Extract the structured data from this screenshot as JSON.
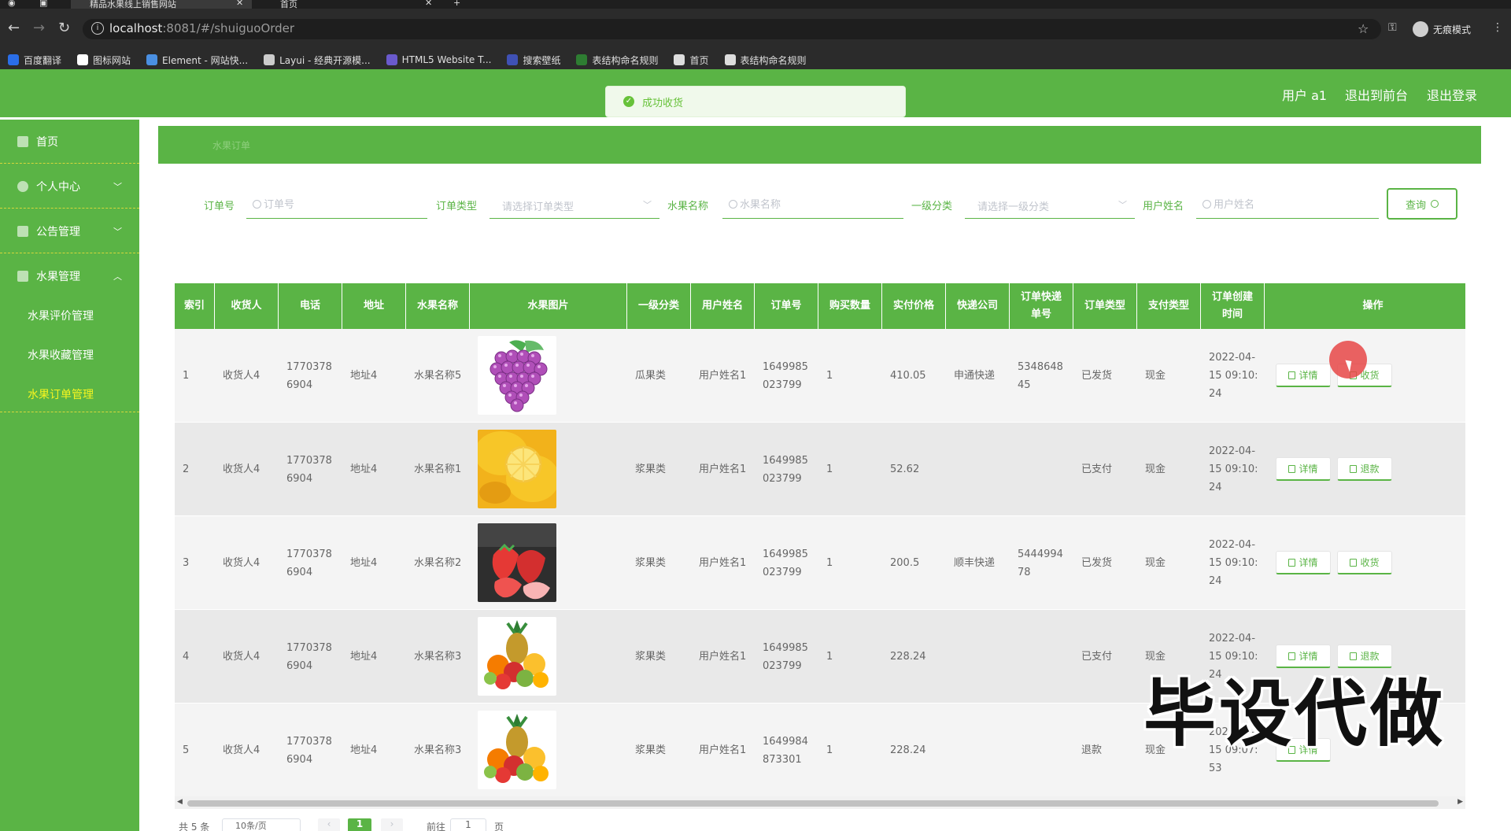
{
  "browser": {
    "tabs": [
      {
        "label": "精品水果线上销售网站"
      },
      {
        "label": "首页"
      }
    ],
    "url_host": "localhost",
    "url_rest": ":8081/#/shuiguoOrder",
    "profile_label": "无痕模式",
    "bookmarks": [
      {
        "label": "百度翻译",
        "color": "#2a6ee8"
      },
      {
        "label": "图标网站",
        "color": "#ffffff"
      },
      {
        "label": "Element - 网站快...",
        "color": "#4a90e2"
      },
      {
        "label": "Layui - 经典开源模...",
        "color": "#cccccc"
      },
      {
        "label": "HTML5 Website T...",
        "color": "#6a5acd"
      },
      {
        "label": "搜索壁纸",
        "color": "#3f51b5"
      },
      {
        "label": "表结构命名规则",
        "color": "#2e7d32"
      },
      {
        "label": "首页",
        "color": "#dddddd"
      },
      {
        "label": "表结构命名规则",
        "color": "#dddddd"
      }
    ]
  },
  "header": {
    "user": "用户 a1",
    "to_front": "退出到前台",
    "logout": "退出登录"
  },
  "toast": {
    "message": "成功收货"
  },
  "sidebar": {
    "items": [
      {
        "label": "首页"
      },
      {
        "label": "个人中心"
      },
      {
        "label": "公告管理"
      },
      {
        "label": "水果管理"
      }
    ],
    "sub_items": [
      {
        "label": "水果评价管理"
      },
      {
        "label": "水果收藏管理"
      },
      {
        "label": "水果订单管理"
      }
    ]
  },
  "breadcrumb": "水果订单",
  "filters": {
    "order_no_label": "订单号",
    "order_no_placeholder": "订单号",
    "order_type_label": "订单类型",
    "order_type_placeholder": "请选择订单类型",
    "fruit_name_label": "水果名称",
    "fruit_name_placeholder": "水果名称",
    "category_label": "一级分类",
    "category_placeholder": "请选择一级分类",
    "username_label": "用户姓名",
    "username_placeholder": "用户姓名",
    "query_button": "查询"
  },
  "table": {
    "headers": [
      "索引",
      "收货人",
      "电话",
      "地址",
      "水果名称",
      "水果图片",
      "一级分类",
      "用户姓名",
      "订单号",
      "购买数量",
      "实付价格",
      "快递公司",
      "订单快递单号",
      "订单类型",
      "支付类型",
      "订单创建时间",
      "操作"
    ],
    "rows": [
      {
        "index": "1",
        "receiver": "收货人4",
        "phone": "17703786904",
        "address": "地址4",
        "fruit": "水果名称5",
        "image": "grape",
        "category": "瓜果类",
        "user": "用户姓名1",
        "order_no": "1649985023799",
        "qty": "1",
        "price": "410.05",
        "express": "申通快递",
        "tracking": "534864845",
        "type": "已发货",
        "pay": "现金",
        "created": "2022-04-15 09:10:24",
        "btn1": "详情",
        "btn2": "收货"
      },
      {
        "index": "2",
        "receiver": "收货人4",
        "phone": "17703786904",
        "address": "地址4",
        "fruit": "水果名称1",
        "image": "lemon",
        "category": "浆果类",
        "user": "用户姓名1",
        "order_no": "1649985023799",
        "qty": "1",
        "price": "52.62",
        "express": "",
        "tracking": "",
        "type": "已支付",
        "pay": "现金",
        "created": "2022-04-15 09:10:24",
        "btn1": "详情",
        "btn2": "退款"
      },
      {
        "index": "3",
        "receiver": "收货人4",
        "phone": "17703786904",
        "address": "地址4",
        "fruit": "水果名称2",
        "image": "strawberry",
        "category": "浆果类",
        "user": "用户姓名1",
        "order_no": "1649985023799",
        "qty": "1",
        "price": "200.5",
        "express": "顺丰快递",
        "tracking": "544499478",
        "type": "已发货",
        "pay": "现金",
        "created": "2022-04-15 09:10:24",
        "btn1": "详情",
        "btn2": "收货"
      },
      {
        "index": "4",
        "receiver": "收货人4",
        "phone": "17703786904",
        "address": "地址4",
        "fruit": "水果名称3",
        "image": "mixed",
        "category": "浆果类",
        "user": "用户姓名1",
        "order_no": "1649985023799",
        "qty": "1",
        "price": "228.24",
        "express": "",
        "tracking": "",
        "type": "已支付",
        "pay": "现金",
        "created": "2022-04-15 09:10:24",
        "btn1": "详情",
        "btn2": "退款"
      },
      {
        "index": "5",
        "receiver": "收货人4",
        "phone": "17703786904",
        "address": "地址4",
        "fruit": "水果名称3",
        "image": "mixed",
        "category": "浆果类",
        "user": "用户姓名1",
        "order_no": "1649984873301",
        "qty": "1",
        "price": "228.24",
        "express": "",
        "tracking": "",
        "type": "退款",
        "pay": "现金",
        "created": "2022-04-15 09:07:53",
        "btn1": "详情",
        "btn2": ""
      }
    ]
  },
  "pagination": {
    "total": "共 5 条",
    "page_size": "10条/页",
    "prev": "‹",
    "current": "1",
    "next": "›",
    "goto": "前往",
    "goto_value": "1",
    "page_unit": "页"
  },
  "watermark": "毕设代做",
  "colors": {
    "primary": "#5ab445",
    "highlight": "#f5f520",
    "toast": "#67c23a"
  }
}
